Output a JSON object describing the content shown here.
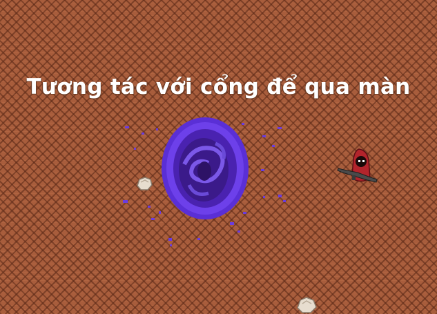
{
  "hud": {
    "hint_text": "Tương tác với cổng để qua màn"
  },
  "colors": {
    "ground": "#a85d3c",
    "portal_outer": "#5a2fd6",
    "portal_inner": "#3b1a8a",
    "cloak": "#b3242c",
    "hint_text": "#ffffff"
  },
  "icons": {
    "portal": "portal-icon",
    "player": "hooded-player-icon",
    "rock": "rock-icon",
    "weapon": "gun-icon"
  }
}
